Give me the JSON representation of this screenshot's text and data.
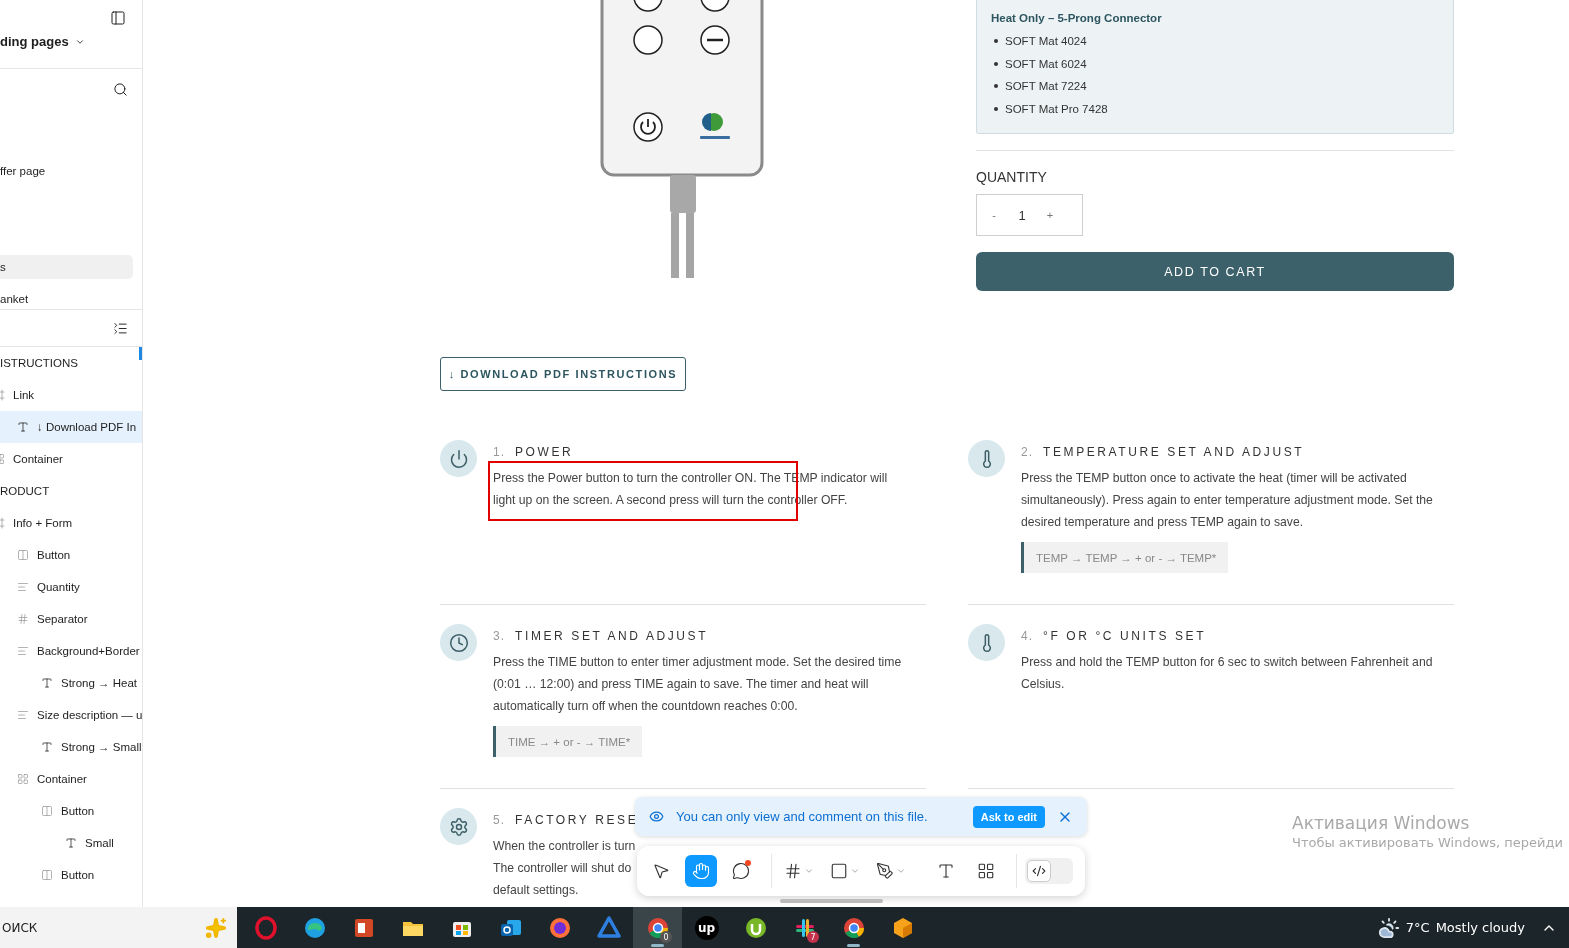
{
  "sidebar": {
    "page_selector": "ding pages",
    "pages": [
      {
        "label": "ffer page",
        "selected": false
      },
      {
        "label": "s",
        "selected": true
      },
      {
        "label": "anket",
        "selected": false
      }
    ],
    "layers": [
      {
        "name": "ISTRUCTIONS",
        "selected": false,
        "children": [
          {
            "name": "Link",
            "kind": "frame",
            "selected": false,
            "children": [
              {
                "name": "↓ Download PDF In",
                "kind": "text",
                "selected": true
              }
            ]
          },
          {
            "name": "Container",
            "kind": "container",
            "selected": false
          }
        ]
      },
      {
        "name": "RODUCT",
        "selected": false,
        "children": [
          {
            "name": "Info + Form",
            "kind": "frame",
            "selected": false,
            "children": [
              {
                "name": "Button",
                "kind": "button",
                "selected": false
              },
              {
                "name": "Quantity",
                "kind": "stack",
                "selected": false
              },
              {
                "name": "Separator",
                "kind": "grid",
                "selected": false
              },
              {
                "name": "Background+Border",
                "kind": "stack",
                "selected": false,
                "children": [
                  {
                    "name": "Strong → Heat",
                    "kind": "text",
                    "selected": false
                  }
                ]
              },
              {
                "name": "Size description — u",
                "kind": "stack",
                "selected": false,
                "children": [
                  {
                    "name": "Strong → Small",
                    "kind": "text",
                    "selected": false
                  }
                ]
              },
              {
                "name": "Container",
                "kind": "container",
                "selected": false,
                "children": [
                  {
                    "name": "Button",
                    "kind": "button",
                    "selected": false,
                    "children": [
                      {
                        "name": "Small",
                        "kind": "text",
                        "selected": false
                      }
                    ]
                  },
                  {
                    "name": "Button",
                    "kind": "button",
                    "selected": false
                  }
                ]
              }
            ]
          }
        ]
      }
    ]
  },
  "product": {
    "compatibility": {
      "title": "Heat Only – 5-Prong Connector",
      "items": [
        "SOFT Mat 4024",
        "SOFT Mat 6024",
        "SOFT Mat 7224",
        "SOFT Mat Pro 7428"
      ]
    },
    "quantity": {
      "label": "QUANTITY",
      "decrement": "-",
      "value": "1",
      "increment": "+"
    },
    "add_to_cart": "ADD TO CART"
  },
  "download_button": "↓ DOWNLOAD PDF INSTRUCTIONS",
  "steps": [
    {
      "number": "1.",
      "title": "POWER",
      "kind": "power",
      "highlighted": true,
      "body": "Press the Power button to turn the controller ON. The TEMP indicator will light up on the screen. A second press will turn the controller OFF."
    },
    {
      "number": "2.",
      "title": "TEMPERATURE SET AND ADJUST",
      "kind": "thermometer",
      "highlighted": false,
      "body": "Press the TEMP button once to activate the heat (timer will be activated simultaneously). Press again to enter temperature adjustment mode. Set the desired temperature and press TEMP again to save.",
      "sequence": "TEMP → TEMP → + or - → TEMP*"
    },
    {
      "number": "3.",
      "title": "TIMER SET AND ADJUST",
      "kind": "clock",
      "highlighted": false,
      "body": "Press the TIME button to enter timer adjustment mode. Set the desired time (0:01 … 12:00) and press TIME again to save. The timer and heat will automatically turn off when the countdown reaches 0:00.",
      "sequence": "TIME → + or - → TIME*"
    },
    {
      "number": "4.",
      "title": "°F OR °C UNITS SET",
      "kind": "thermometer",
      "highlighted": false,
      "body": "Press and hold the TEMP button for 6 sec to switch between Fahrenheit and Celsius."
    },
    {
      "number": "5.",
      "title": "FACTORY RESE",
      "kind": "gear",
      "highlighted": false,
      "body_lines": [
        "When the controller is turn",
        "The controller will shut do",
        "default settings."
      ]
    }
  ],
  "toast": {
    "message": "You can only view and comment on this file.",
    "action": "Ask to edit"
  },
  "toolbar": {
    "tools": [
      {
        "kind": "move",
        "selected": false
      },
      {
        "kind": "hand",
        "selected": true
      },
      {
        "kind": "comment",
        "selected": false,
        "notification": true
      },
      {
        "kind": "frame",
        "selected": false,
        "menu": true
      },
      {
        "kind": "shape",
        "selected": false,
        "menu": true
      },
      {
        "kind": "pen",
        "selected": false,
        "menu": true
      },
      {
        "kind": "text",
        "selected": false
      },
      {
        "kind": "components",
        "selected": false
      },
      {
        "kind": "dev-mode",
        "selected": false
      }
    ]
  },
  "windows_activation": {
    "title": "Активация Windows",
    "subtitle": "Чтобы активировать Windows, перейди"
  },
  "taskbar": {
    "search": "ОИСК",
    "apps": [
      {
        "kind": "ring",
        "running": false,
        "selected": false
      },
      {
        "kind": "swirl",
        "running": false,
        "selected": false
      },
      {
        "kind": "slides",
        "running": false,
        "selected": false
      },
      {
        "kind": "folder",
        "running": false,
        "selected": false
      },
      {
        "kind": "bag",
        "running": false,
        "selected": false
      },
      {
        "kind": "mail",
        "running": false,
        "selected": false
      },
      {
        "kind": "globe",
        "running": false,
        "selected": false
      },
      {
        "kind": "knot",
        "running": false,
        "selected": false
      },
      {
        "kind": "wheel",
        "running": true,
        "selected": true,
        "badge": "0"
      },
      {
        "kind": "wordmark",
        "label": "up",
        "running": false,
        "selected": false
      },
      {
        "kind": "leaf",
        "running": false,
        "selected": false
      },
      {
        "kind": "hash",
        "running": false,
        "selected": false,
        "badge": "7"
      },
      {
        "kind": "wheel",
        "running": true,
        "selected": false
      },
      {
        "kind": "cube",
        "running": false,
        "selected": false
      }
    ],
    "weather": {
      "temperature": "7°C",
      "condition": "Mostly cloudy"
    }
  }
}
